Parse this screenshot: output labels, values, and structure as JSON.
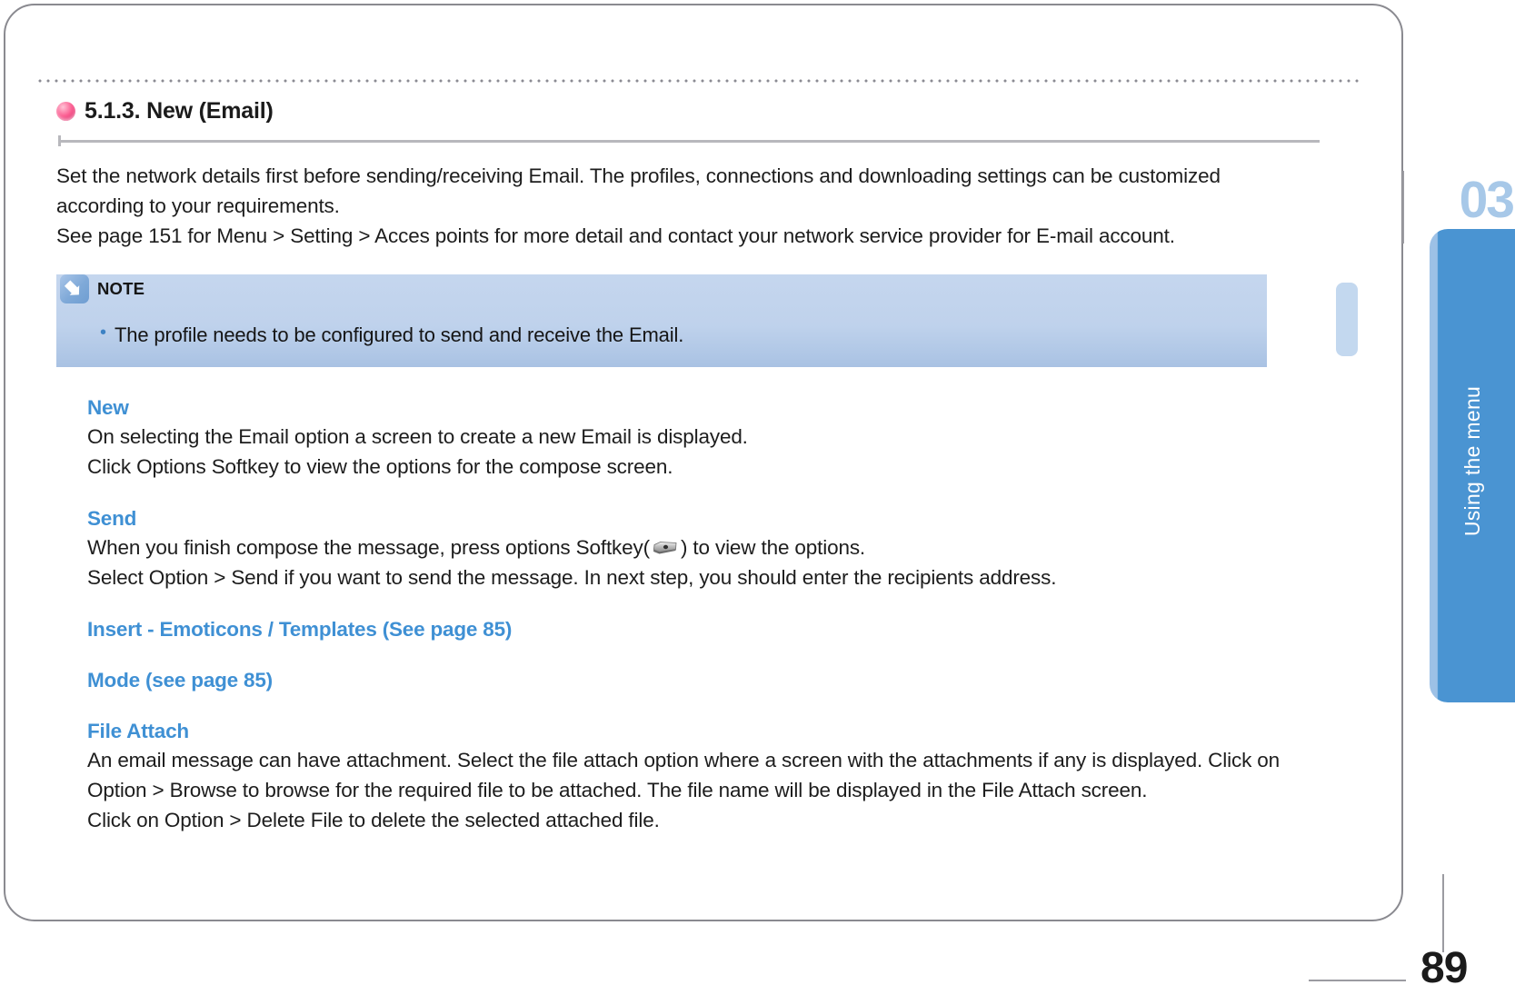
{
  "page": {
    "number": "89",
    "chapter_number": "03",
    "chapter_tab_label": "Using the menu"
  },
  "section": {
    "bullet_icon": "pink-dot-icon",
    "title": "5.1.3. New (Email)"
  },
  "intro": {
    "paragraph_1": "Set the network details first before sending/receiving Email. The profiles, connections and downloading settings can be customized according to your requirements.",
    "paragraph_2": "See page 151 for Menu > Setting > Acces points for more detail and contact your network service provider for E-mail account."
  },
  "note": {
    "icon": "note-arrow-icon",
    "label": "NOTE",
    "items": [
      "The profile needs to be configured to send and receive the Email."
    ]
  },
  "sections": [
    {
      "heading": "New",
      "lines": [
        "On selecting the Email option a screen to create a new Email is displayed.",
        "Click Options Softkey to view the options for the compose screen."
      ]
    },
    {
      "heading": "Send",
      "send_line_1_before": "When you finish compose the message, press options Softkey(",
      "send_icon": "softkey-icon",
      "send_line_1_after": ") to view the options.",
      "send_line_2": "Select Option > Send if you want to send the message. In next step, you should enter the recipients address."
    },
    {
      "heading": "Insert - Emoticons / Templates (See page 85)"
    },
    {
      "heading": "Mode (see page 85)"
    },
    {
      "heading": "File Attach",
      "paragraph_1": "An email message can have attachment. Select the file attach option where a screen with the attachments if any is displayed. Click on Option > Browse to browse for the required file to be attached. The file name will be displayed in the File Attach screen.",
      "paragraph_2": "Click on Option > Delete File to delete the selected attached file."
    }
  ],
  "colors": {
    "heading_blue": "#3f90d4",
    "tab_blue": "#4a94d2",
    "chapter_number_blue": "#a7c8e8",
    "note_bg": "#bfd2ec",
    "bullet_pink": "#fb5f92"
  }
}
